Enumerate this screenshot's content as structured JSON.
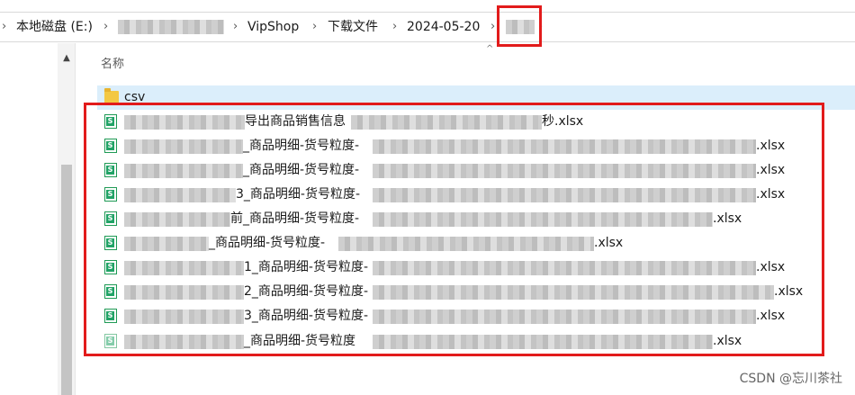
{
  "breadcrumb": {
    "drive": "本地磁盘 (E:)",
    "path": [
      "VipShop",
      "下载文件",
      "2024-05-20"
    ],
    "separator": "›",
    "end_chevron": "›"
  },
  "list": {
    "column_header": "名称",
    "sort_indicator": "^",
    "folder": {
      "name": "csv"
    },
    "files": [
      {
        "part1": "导出商品销售信息",
        "ext": "秒.xlsx"
      },
      {
        "part1": "_商品明细-货号粒度-",
        "ext": ".xlsx"
      },
      {
        "part1": "_商品明细-货号粒度-",
        "ext": ".xlsx"
      },
      {
        "part1": "3_商品明细-货号粒度-",
        "ext": ".xlsx"
      },
      {
        "part1": "前_商品明细-货号粒度-",
        "ext": ".xlsx"
      },
      {
        "part1": "_商品明细-货号粒度-",
        "ext": ".xlsx"
      },
      {
        "part1": "1_商品明细-货号粒度-",
        "ext": ".xlsx"
      },
      {
        "part1": "2_商品明细-货号粒度-",
        "ext": ".xlsx"
      },
      {
        "part1": "3_商品明细-货号粒度-",
        "ext": ".xlsx"
      },
      {
        "part1": "_商品明细-货号粒度",
        "ext": ".xlsx"
      }
    ]
  },
  "watermark": "CSDN @忘川茶社",
  "colors": {
    "highlight": "#e21b1b",
    "selection": "#dbeefb",
    "excel": "#21a366"
  }
}
